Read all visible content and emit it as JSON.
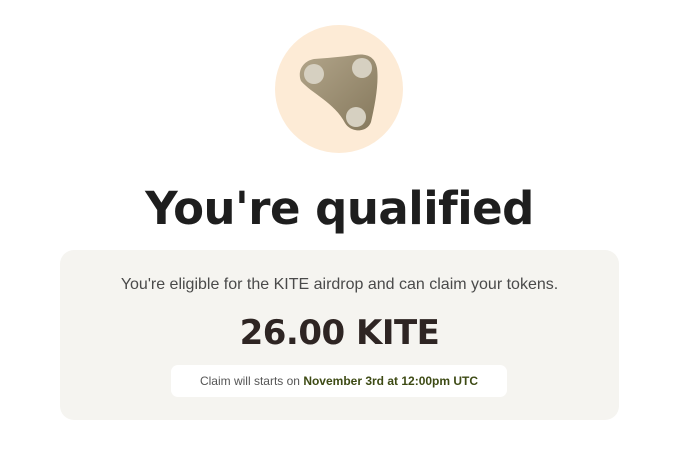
{
  "logo": {
    "icon": "kite-logo-icon",
    "background_color": "#fdebd6",
    "shape_color": "#9a8a6c",
    "dot_color": "#d6d0c1"
  },
  "headline": "You're qualified",
  "card": {
    "description": "You're eligible for the KITE airdrop and can claim your tokens.",
    "amount": "26.00 KITE",
    "claim_prefix": "Claim will starts on",
    "claim_date": "November 3rd at 12:00pm UTC",
    "claim_date_color": "#3d4a14",
    "background_color": "#f5f4f0"
  }
}
